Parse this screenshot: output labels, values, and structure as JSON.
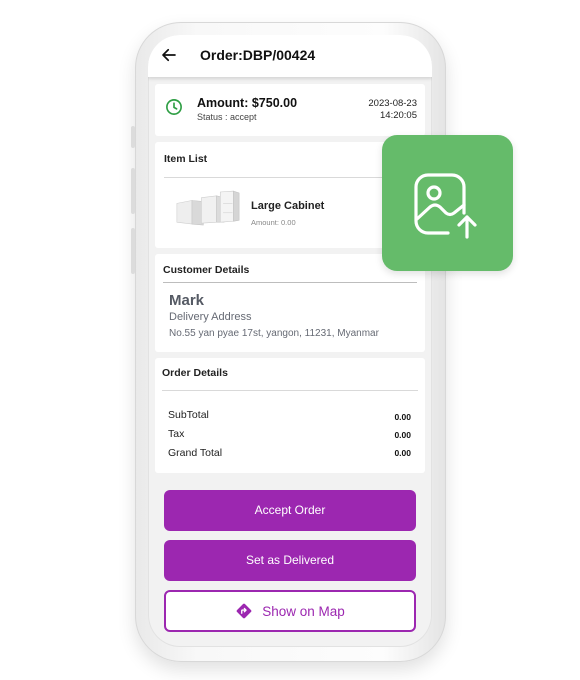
{
  "app_bar": {
    "title": "Order:DBP/00424",
    "back_icon": "arrow-left-icon"
  },
  "summary": {
    "amount": "Amount: $750.00",
    "status": "Status : accept",
    "date": "2023-08-23",
    "time": "14:20:05",
    "clock_icon": "clock-icon",
    "accent_color": "#2e9e44"
  },
  "item_list": {
    "title": "Item List",
    "items": [
      {
        "name": "Large Cabinet",
        "amount": "Amount: 0.00"
      }
    ]
  },
  "customer": {
    "title": "Customer Details",
    "name": "Mark",
    "address_label": "Delivery Address",
    "address": "No.55 yan pyae 17st, yangon, 11231, Myanmar"
  },
  "order_details": {
    "title": "Order Details",
    "rows": [
      {
        "label": "SubTotal",
        "value": "0.00"
      },
      {
        "label": "Tax",
        "value": "0.00"
      },
      {
        "label": "Grand Total",
        "value": "0.00"
      }
    ]
  },
  "actions": {
    "accept": "Accept Order",
    "delivered": "Set as Delivered",
    "map": "Show on Map",
    "map_icon": "directions-icon",
    "primary_color": "#9c27b0"
  },
  "overlay": {
    "icon": "image-upload-icon",
    "color": "#65bb6a"
  }
}
